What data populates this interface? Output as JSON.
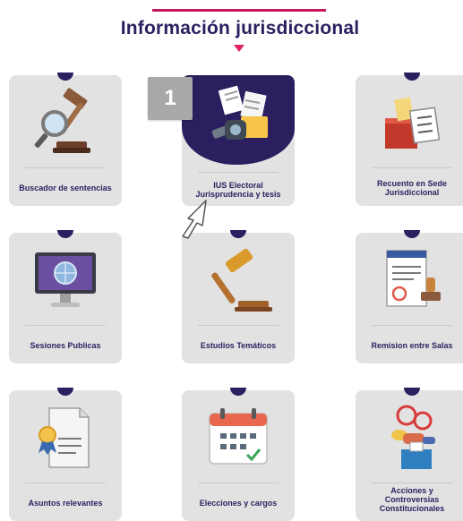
{
  "header": {
    "title": "Información jurisdiccional"
  },
  "badge": {
    "number": "1"
  },
  "cards": [
    {
      "id": "buscador",
      "lines": [
        "Buscador de sentencias"
      ],
      "icon": "gavel-magnifier-icon"
    },
    {
      "id": "ius",
      "lines": [
        "IUS Electoral",
        "Jurisprudencia y tesis"
      ],
      "icon": "binoculars-documents-icon"
    },
    {
      "id": "recuento",
      "lines": [
        "Recuento en Sede",
        "Jurisdiccional"
      ],
      "icon": "ballot-box-icon"
    },
    {
      "id": "sesiones",
      "lines": [
        "Sesiones Publicas"
      ],
      "icon": "monitor-globe-icon"
    },
    {
      "id": "estudios",
      "lines": [
        "Estudios Temáticos"
      ],
      "icon": "gavel-icon"
    },
    {
      "id": "remision",
      "lines": [
        "Remision entre Salas"
      ],
      "icon": "document-stamp-icon"
    },
    {
      "id": "asuntos",
      "lines": [
        "Asuntos relevantes"
      ],
      "icon": "certificate-icon"
    },
    {
      "id": "elecciones",
      "lines": [
        "Elecciones y cargos"
      ],
      "icon": "calendar-icon"
    },
    {
      "id": "acciones",
      "lines": [
        "Acciones y",
        "Controversias",
        "Constitucionales"
      ],
      "icon": "people-vote-icon"
    }
  ],
  "colors": {
    "navy": "#2b1f5f",
    "accent": "#e0245e",
    "card": "#e2e2e2"
  }
}
